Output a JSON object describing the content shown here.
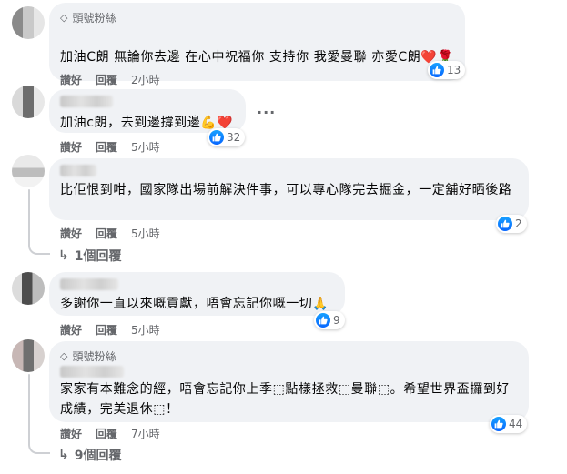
{
  "comments": [
    {
      "badge": "頭號粉絲",
      "text": "加油C朗 無論你去邊 在心中祝福你 支持你 我愛曼聯 亦愛C朗",
      "emoji": "❤️🌹",
      "reactions": "13",
      "like": "讚好",
      "reply": "回覆",
      "time": "2小時"
    },
    {
      "text": "加油c朗，去到邊撐到邊",
      "emoji": "💪❤️",
      "reactions": "32",
      "like": "讚好",
      "reply": "回覆",
      "time": "5小時"
    },
    {
      "text": "比佢恨到咁，國家隊出場前解決件事，可以專心隊完去掘金，一定舖好晒後路",
      "reactions": "2",
      "like": "讚好",
      "reply": "回覆",
      "time": "5小時",
      "replies": "1個回覆"
    },
    {
      "text": "多謝你一直以來嘅貢獻，唔會忘記你嘅一切",
      "emoji": "🙏",
      "reactions": "9",
      "like": "讚好",
      "reply": "回覆",
      "time": "5小時"
    },
    {
      "badge": "頭號粉絲",
      "text": "家家有本難念的經，唔會忘記你上季⬚點樣拯救⬚曼聯⬚。希望世界盃攞到好成績，完美退休⬚！",
      "reactions": "44",
      "like": "讚好",
      "reply": "回覆",
      "time": "7小時",
      "replies": "9個回覆"
    }
  ],
  "icons": {
    "badge": "diamond-icon",
    "reaction": "like-icon",
    "reply_arrow": "reply-arrow-icon",
    "more": "more-options-icon"
  },
  "colors": {
    "like_blue": "#0866ff",
    "bubble_bg": "#f0f2f5",
    "meta_text": "#65676b"
  }
}
